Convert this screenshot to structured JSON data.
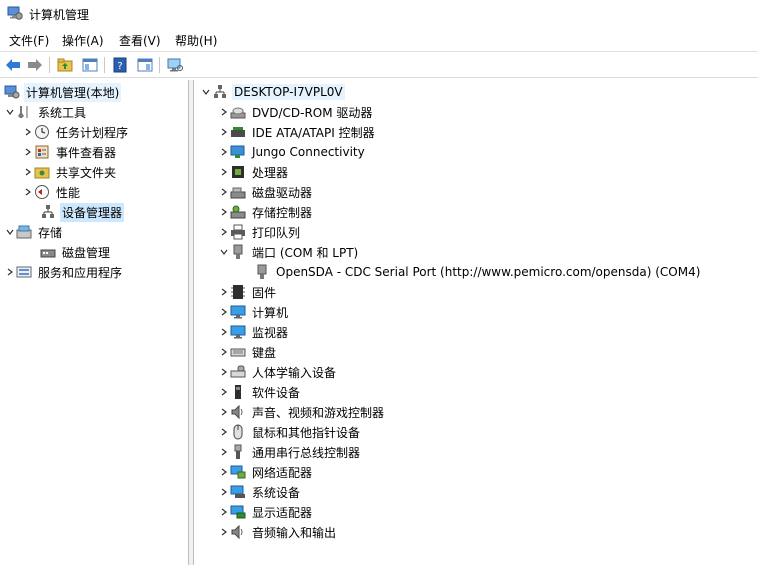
{
  "window": {
    "title": "计算机管理"
  },
  "menu": [
    "文件(F)",
    "操作(A)",
    "查看(V)",
    "帮助(H)"
  ],
  "left_tree": {
    "root": "计算机管理(本地)",
    "system_tools": "系统工具",
    "task_scheduler": "任务计划程序",
    "event_viewer": "事件查看器",
    "shared_folders": "共享文件夹",
    "performance": "性能",
    "device_manager": "设备管理器",
    "storage": "存储",
    "disk_management": "磁盘管理",
    "services_apps": "服务和应用程序"
  },
  "right_tree": {
    "computer": "DESKTOP-I7VPL0V",
    "categories": [
      "DVD/CD-ROM 驱动器",
      "IDE ATA/ATAPI 控制器",
      "Jungo Connectivity",
      "处理器",
      "磁盘驱动器",
      "存储控制器",
      "打印队列",
      "端口 (COM 和 LPT)",
      "OpenSDA - CDC Serial Port (http://www.pemicro.com/opensda) (COM4)",
      "固件",
      "计算机",
      "监视器",
      "键盘",
      "人体学输入设备",
      "软件设备",
      "声音、视频和游戏控制器",
      "鼠标和其他指针设备",
      "通用串行总线控制器",
      "网络适配器",
      "系统设备",
      "显示适配器",
      "音频输入和输出"
    ]
  }
}
